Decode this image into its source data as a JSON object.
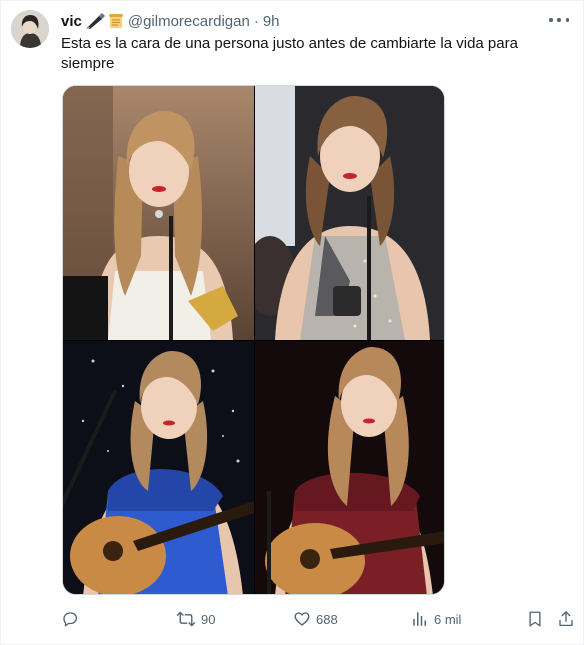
{
  "tweet": {
    "display_name": "vic",
    "handle": "@gilmorecardigan",
    "separator": "·",
    "time": "9h",
    "text": "Esta es la cara de una persona justo antes de cambiarte la vida para siempre",
    "name_emojis": [
      "feather-pen-emoji",
      "scroll-emoji"
    ]
  },
  "media": {
    "layout": "2x2-grid",
    "tiles": [
      {
        "name": "photo-grammys-white-dress",
        "colors": {
          "bg": "#8c6b52",
          "dress": "#f2eee8",
          "hair": "#b78a5a"
        }
      },
      {
        "name": "photo-vmas-sparkle-dress",
        "colors": {
          "bg": "#2a2a2e",
          "dress": "#b9b3ad",
          "hair": "#7a5436"
        }
      },
      {
        "name": "photo-blue-dress-guitar",
        "colors": {
          "bg": "#0d0f18",
          "dress": "#2f5bd1",
          "hair": "#b38a5e"
        }
      },
      {
        "name": "photo-red-dress-guitar",
        "colors": {
          "bg": "#140a0c",
          "dress": "#7a1f26",
          "hair": "#b7895a"
        }
      }
    ]
  },
  "actions": {
    "reply": {
      "icon": "reply-icon",
      "count": ""
    },
    "retweet": {
      "icon": "retweet-icon",
      "count": "90"
    },
    "like": {
      "icon": "heart-icon",
      "count": "688"
    },
    "views": {
      "icon": "views-icon",
      "count": "6 mil"
    },
    "bookmark": {
      "icon": "bookmark-icon"
    },
    "share": {
      "icon": "share-icon"
    }
  },
  "colors": {
    "text_primary": "#0f1419",
    "text_secondary": "#536471",
    "border": "#eff3f4"
  }
}
